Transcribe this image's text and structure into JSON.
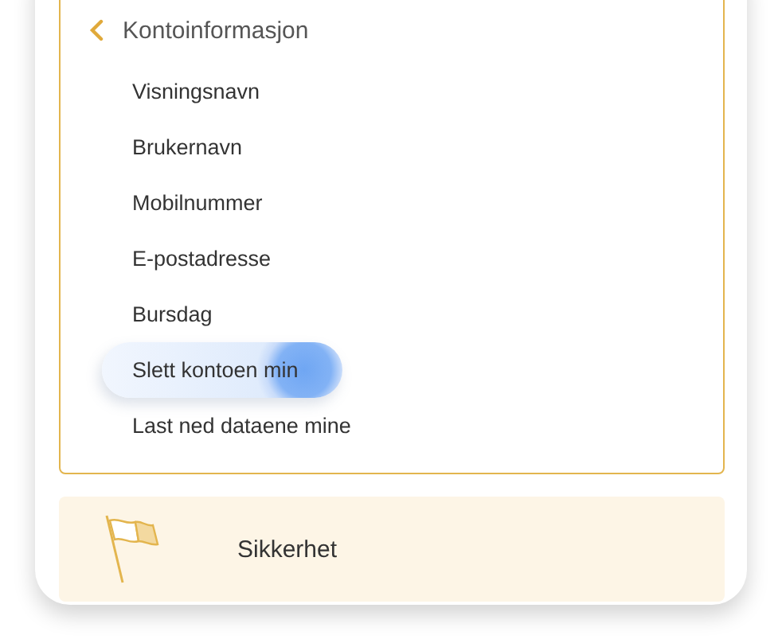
{
  "section": {
    "title": "Kontoinformasjon",
    "items": [
      {
        "label": "Visningsnavn",
        "selected": false
      },
      {
        "label": "Brukernavn",
        "selected": false
      },
      {
        "label": "Mobilnummer",
        "selected": false
      },
      {
        "label": "E-postadresse",
        "selected": false
      },
      {
        "label": "Bursdag",
        "selected": false
      },
      {
        "label": "Slett kontoen min",
        "selected": true
      },
      {
        "label": "Last ned dataene mine",
        "selected": false
      }
    ]
  },
  "next_section": {
    "title": "Sikkerhet"
  }
}
